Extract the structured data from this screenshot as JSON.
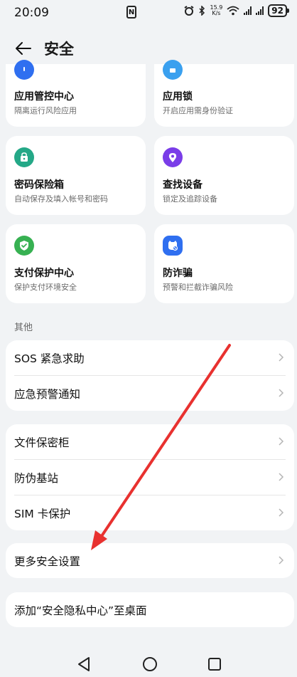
{
  "status_bar": {
    "time": "20:09",
    "nfc": "N",
    "speed_top": "15.9",
    "speed_unit": "K/s",
    "battery": "92"
  },
  "header": {
    "title": "安全"
  },
  "grid": [
    {
      "title": "应用管控中心",
      "subtitle": "隔离运行风险应用",
      "icon": "shield-icon",
      "color": "#2f6ff0"
    },
    {
      "title": "应用锁",
      "subtitle": "开启应用需身份验证",
      "icon": "lock-icon",
      "color": "#3aa0ef"
    },
    {
      "title": "密码保险箱",
      "subtitle": "自动保存及填入帐号和密码",
      "icon": "safe-box-icon",
      "color": "#24a887"
    },
    {
      "title": "查找设备",
      "subtitle": "锁定及追踪设备",
      "icon": "location-pin-icon",
      "color": "#7a3de8"
    },
    {
      "title": "支付保护中心",
      "subtitle": "保护支付环境安全",
      "icon": "check-shield-icon",
      "color": "#37b152"
    },
    {
      "title": "防诈骗",
      "subtitle": "预警和拦截诈骗风险",
      "icon": "anti-fraud-icon",
      "color": "#2f6ff0"
    }
  ],
  "others_label": "其他",
  "list_group_1": [
    {
      "label": "SOS 紧急求助"
    },
    {
      "label": "应急预警通知"
    }
  ],
  "list_group_2": [
    {
      "label": "文件保密柜"
    },
    {
      "label": "防伪基站"
    },
    {
      "label": "SIM 卡保护"
    }
  ],
  "more_settings": "更多安全设置",
  "add_to_desktop": "添加“安全隐私中心”至桌面",
  "annotation_color": "#e8312f"
}
